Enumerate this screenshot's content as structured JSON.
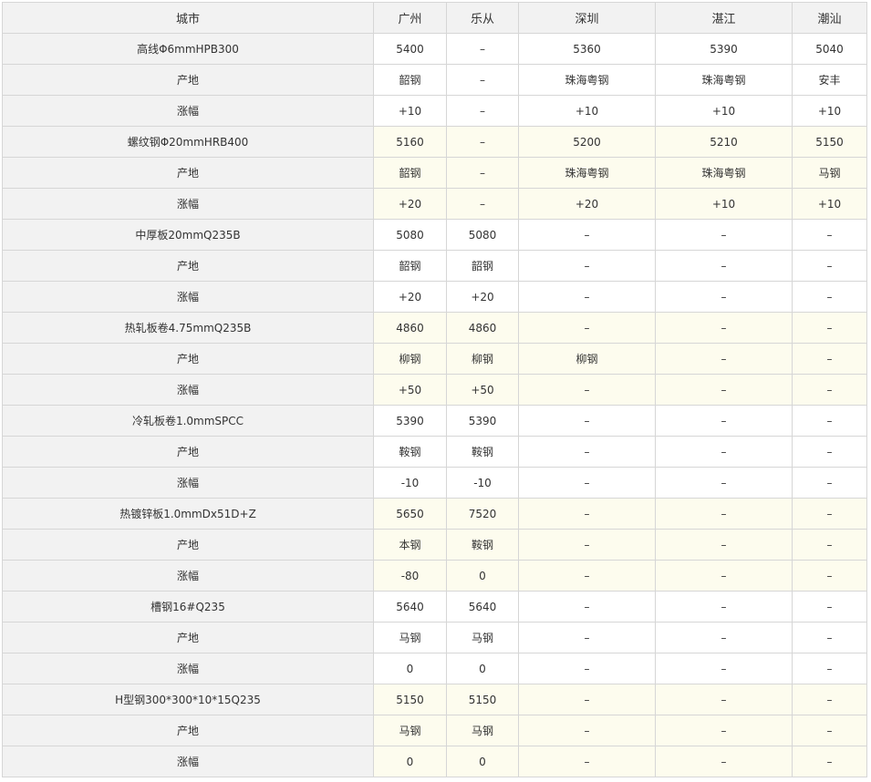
{
  "table": {
    "headers": [
      "城市",
      "广州",
      "乐从",
      "深圳",
      "湛江",
      "潮汕"
    ],
    "groups": [
      {
        "rows": [
          {
            "label": "高线Φ6mmHPB300",
            "values": [
              "5400",
              "–",
              "5360",
              "5390",
              "5040"
            ]
          },
          {
            "label": "产地",
            "values": [
              "韶钢",
              "–",
              "珠海粤钢",
              "珠海粤钢",
              "安丰"
            ]
          },
          {
            "label": "涨幅",
            "values": [
              "+10",
              "–",
              "+10",
              "+10",
              "+10"
            ]
          }
        ]
      },
      {
        "rows": [
          {
            "label": "螺纹钢Φ20mmHRB400",
            "values": [
              "5160",
              "–",
              "5200",
              "5210",
              "5150"
            ]
          },
          {
            "label": "产地",
            "values": [
              "韶钢",
              "–",
              "珠海粤钢",
              "珠海粤钢",
              "马钢"
            ]
          },
          {
            "label": "涨幅",
            "values": [
              "+20",
              "–",
              "+20",
              "+10",
              "+10"
            ]
          }
        ]
      },
      {
        "rows": [
          {
            "label": "中厚板20mmQ235B",
            "values": [
              "5080",
              "5080",
              "–",
              "–",
              "–"
            ]
          },
          {
            "label": "产地",
            "values": [
              "韶钢",
              "韶钢",
              "–",
              "–",
              "–"
            ]
          },
          {
            "label": "涨幅",
            "values": [
              "+20",
              "+20",
              "–",
              "–",
              "–"
            ]
          }
        ]
      },
      {
        "rows": [
          {
            "label": "热轧板卷4.75mmQ235B",
            "values": [
              "4860",
              "4860",
              "–",
              "–",
              "–"
            ]
          },
          {
            "label": "产地",
            "values": [
              "柳钢",
              "柳钢",
              "柳钢",
              "–",
              "–"
            ]
          },
          {
            "label": "涨幅",
            "values": [
              "+50",
              "+50",
              "–",
              "–",
              "–"
            ]
          }
        ]
      },
      {
        "rows": [
          {
            "label": "冷轧板卷1.0mmSPCC",
            "values": [
              "5390",
              "5390",
              "–",
              "–",
              "–"
            ]
          },
          {
            "label": "产地",
            "values": [
              "鞍钢",
              "鞍钢",
              "–",
              "–",
              "–"
            ]
          },
          {
            "label": "涨幅",
            "values": [
              "-10",
              "-10",
              "–",
              "–",
              "–"
            ]
          }
        ]
      },
      {
        "rows": [
          {
            "label": "热镀锌板1.0mmDx51D+Z",
            "values": [
              "5650",
              "7520",
              "–",
              "–",
              "–"
            ]
          },
          {
            "label": "产地",
            "values": [
              "本钢",
              "鞍钢",
              "–",
              "–",
              "–"
            ]
          },
          {
            "label": "涨幅",
            "values": [
              "-80",
              "0",
              "–",
              "–",
              "–"
            ]
          }
        ]
      },
      {
        "rows": [
          {
            "label": "槽钢16#Q235",
            "values": [
              "5640",
              "5640",
              "–",
              "–",
              "–"
            ]
          },
          {
            "label": "产地",
            "values": [
              "马钢",
              "马钢",
              "–",
              "–",
              "–"
            ]
          },
          {
            "label": "涨幅",
            "values": [
              "0",
              "0",
              "–",
              "–",
              "–"
            ]
          }
        ]
      },
      {
        "rows": [
          {
            "label": "H型钢300*300*10*15Q235",
            "values": [
              "5150",
              "5150",
              "–",
              "–",
              "–"
            ]
          },
          {
            "label": "产地",
            "values": [
              "马钢",
              "马钢",
              "–",
              "–",
              "–"
            ]
          },
          {
            "label": "涨幅",
            "values": [
              "0",
              "0",
              "–",
              "–",
              "–"
            ]
          }
        ]
      }
    ]
  }
}
